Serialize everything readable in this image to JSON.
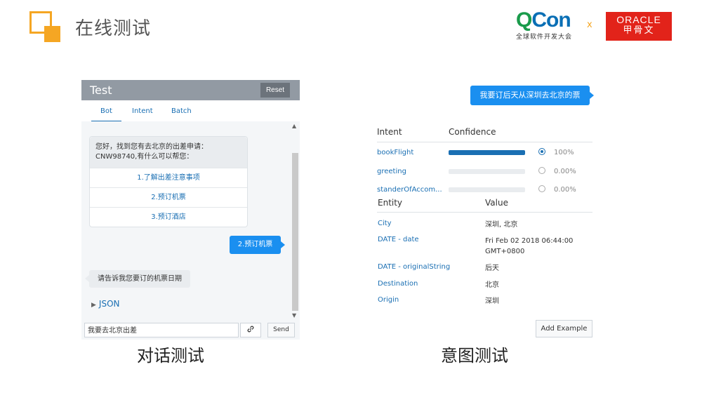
{
  "header": {
    "title": "在线测试",
    "qcon_main_q": "Q",
    "qcon_main_c": "Con",
    "qcon_sub": "全球软件开发大会",
    "times": "x",
    "oracle_en": "ORACLE",
    "oracle_cn": "甲骨文"
  },
  "left_panel": {
    "title": "Test",
    "reset_label": "Reset",
    "tabs": [
      {
        "label": "Bot",
        "active": true
      },
      {
        "label": "Intent",
        "active": false
      },
      {
        "label": "Batch",
        "active": false
      }
    ],
    "bot_message": "您好，找到您有去北京的出差申请：CNW98740,有什么可以帮您：",
    "options": [
      "1.了解出差注意事项",
      "2.预订机票",
      "3.预订酒店"
    ],
    "user_reply": "2.预订机票",
    "bot_reply": "请告诉我您要订的机票日期",
    "json_label": "JSON",
    "input_value": "我要去北京出差",
    "link_icon": "link-icon",
    "send_label": "Send",
    "caption": "对话测试"
  },
  "right_panel": {
    "user_bubble": "我要订后天从深圳去北京的票",
    "intent_header": "Intent",
    "confidence_header": "Confidence",
    "intents": [
      {
        "name": "bookFlight",
        "confidence": 1.0,
        "percent": "100%",
        "selected": true
      },
      {
        "name": "greeting",
        "confidence": 0.0,
        "percent": "0.00%",
        "selected": false
      },
      {
        "name": "standerOfAccom...",
        "confidence": 0.0,
        "percent": "0.00%",
        "selected": false
      }
    ],
    "entity_header": "Entity",
    "value_header": "Value",
    "entities": [
      {
        "entity": "City",
        "value": "深圳, 北京"
      },
      {
        "entity": "DATE - date",
        "value": "Fri Feb 02 2018 06:44:00",
        "value2": "GMT+0800"
      },
      {
        "entity": "DATE - originalString",
        "value": "后天"
      },
      {
        "entity": "Destination",
        "value": "北京"
      },
      {
        "entity": "Origin",
        "value": "深圳"
      }
    ],
    "add_example_label": "Add Example",
    "caption": "意图测试"
  },
  "colors": {
    "accent_orange": "#f5a623",
    "link_blue": "#1a6fb3",
    "bubble_blue": "#1a8ff0",
    "oracle_red": "#e2231a",
    "qcon_green": "#1a9b4b"
  }
}
